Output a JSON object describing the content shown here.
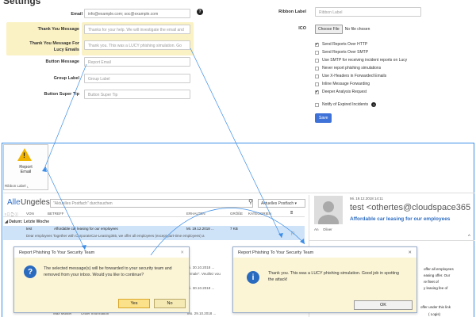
{
  "settings": {
    "title": "Settings",
    "email": {
      "label": "Email",
      "value": "info@example.com; soc@example.com"
    },
    "thanks": {
      "label": "Thank You Message",
      "value": "Thanks for your help. We will investigate the email and"
    },
    "thanks_lucy": {
      "label1": "Thank You Message For",
      "label2": "Lucy Emails",
      "value": "Thank you. This was a LUCY phishing simulation. Go"
    },
    "button_message": {
      "label": "Button Message",
      "value": "Report Email"
    },
    "group_label": {
      "label": "Group Label",
      "value": "Group Label"
    },
    "super_tip": {
      "label": "Button Super Tip",
      "value": "Button Super Tip"
    },
    "ribbon_label": {
      "label": "Ribbon Label",
      "value": "Ribbon Label"
    },
    "ico": {
      "label": "ICO",
      "button": "Choose File",
      "status": "No file chosen"
    },
    "options": [
      {
        "label": "Send Reports Over HTTP",
        "checked": true
      },
      {
        "label": "Send Reports Over SMTP",
        "checked": false
      },
      {
        "label": "Use SMTP for receiving incident reports on Lucy",
        "checked": false
      },
      {
        "label": "Never report phishing simulations",
        "checked": false
      },
      {
        "label": "Use X-Headers in Forwarded Emails",
        "checked": false
      },
      {
        "label": "Inline Message Forwarding",
        "checked": false
      },
      {
        "label": "Deeper Analysis Request",
        "checked": true
      }
    ],
    "notify": {
      "label": "Notify of Expired Incidents",
      "checked": false
    },
    "save": "Save"
  },
  "ribbon": {
    "button1": "Report",
    "button2": "Email",
    "group": "Ribbon Label"
  },
  "outlook": {
    "tab_all": "Alle",
    "tab_unread": "Ungelesen",
    "search_placeholder": "\"Aktuelles Postfach\" durchsuchen",
    "mailbox": "Aktuelles Postfach",
    "cols": {
      "from": "VON",
      "subject": "BETREFF",
      "received": "ERHALTEN",
      "size": "GRÖßE",
      "categories": "KATEGORIEN"
    },
    "group": "Datum: Letzte Woche",
    "row1": {
      "from": "test",
      "subject": "Affordable car leasing for our employees",
      "date": "Mi. 19.12.2018 ...",
      "size": "7 KB",
      "preview": "Dear employees  Together with CorporateCar-Leasing365, we offer all employees (except part-time employees) a"
    },
    "row_dates": [
      "Di. 30.10.2018 ...",
      "Di. 30.10.2018 ...",
      "Mo. 29.10.2018 ..."
    ],
    "row_frag": "ormale\". Veuillez vou",
    "row_from_last": "Max Muster",
    "row_subj_last": "Order Information"
  },
  "reading": {
    "date": "Mi. 19.12.2018 14:11",
    "sender": "test <othertes@cloudspace365",
    "subject": "Affordable car leasing for our employees",
    "to_label": "An",
    "to": "Oliver",
    "frag1": "offer all employees",
    "frag2": "easing offer. Our",
    "frag3": "re fleet of",
    "frag4": "y leasing fee of",
    "frag5": "offer under this link",
    "frag6": "( Logis)"
  },
  "dialog1": {
    "title": "Report Phishing To Your Security Team",
    "text1": "The selected message(s) will be forwarded to your security team and",
    "text2": "removed from your inbox. Would you like to continue?",
    "yes": "Yes",
    "no": "No"
  },
  "dialog2": {
    "title": "Report Phishing To Your Security Team",
    "text1": "Thank you. This was a LUCY phishing simulation. Good job in spotting",
    "text2": "the attack!",
    "ok": "OK"
  },
  "colors": {
    "accent": "#3d8ee8",
    "highlight": "#faf1c4",
    "dialog_body": "#fbf5d6",
    "save": "#3f72d8",
    "warning": "#f0b400"
  }
}
